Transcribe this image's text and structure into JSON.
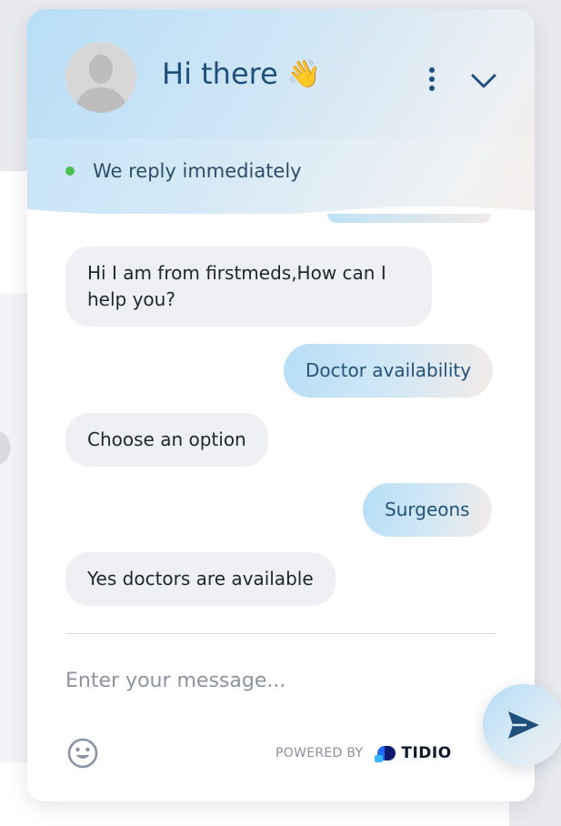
{
  "header": {
    "title": "Hi there",
    "wave_emoji": "👋",
    "status_text": "We reply immediately",
    "status_color": "#4cc04f"
  },
  "messages": [
    {
      "sender": "bot",
      "text": "Hi I am from firstmeds,How can I help you?"
    },
    {
      "sender": "user",
      "text": "Doctor availability"
    },
    {
      "sender": "bot",
      "text": "Choose an option"
    },
    {
      "sender": "user",
      "text": "Surgeons"
    },
    {
      "sender": "bot",
      "text": "Yes doctors are available"
    }
  ],
  "composer": {
    "placeholder": "Enter your message...",
    "powered_by": "POWERED BY",
    "brand": "TIDIO"
  },
  "icons": {
    "avatar": "user-avatar-icon",
    "menu": "vertical-dots-icon",
    "collapse": "chevron-down-icon",
    "emoji": "smiley-icon",
    "send": "paper-plane-icon",
    "brand": "tidio-logo-icon"
  },
  "colors": {
    "header_gradient_start": "#b8def7",
    "header_gradient_end": "#f5ece8",
    "title": "#1f4f7a",
    "bot_bubble": "#eff0f4",
    "user_text": "#23527c"
  }
}
